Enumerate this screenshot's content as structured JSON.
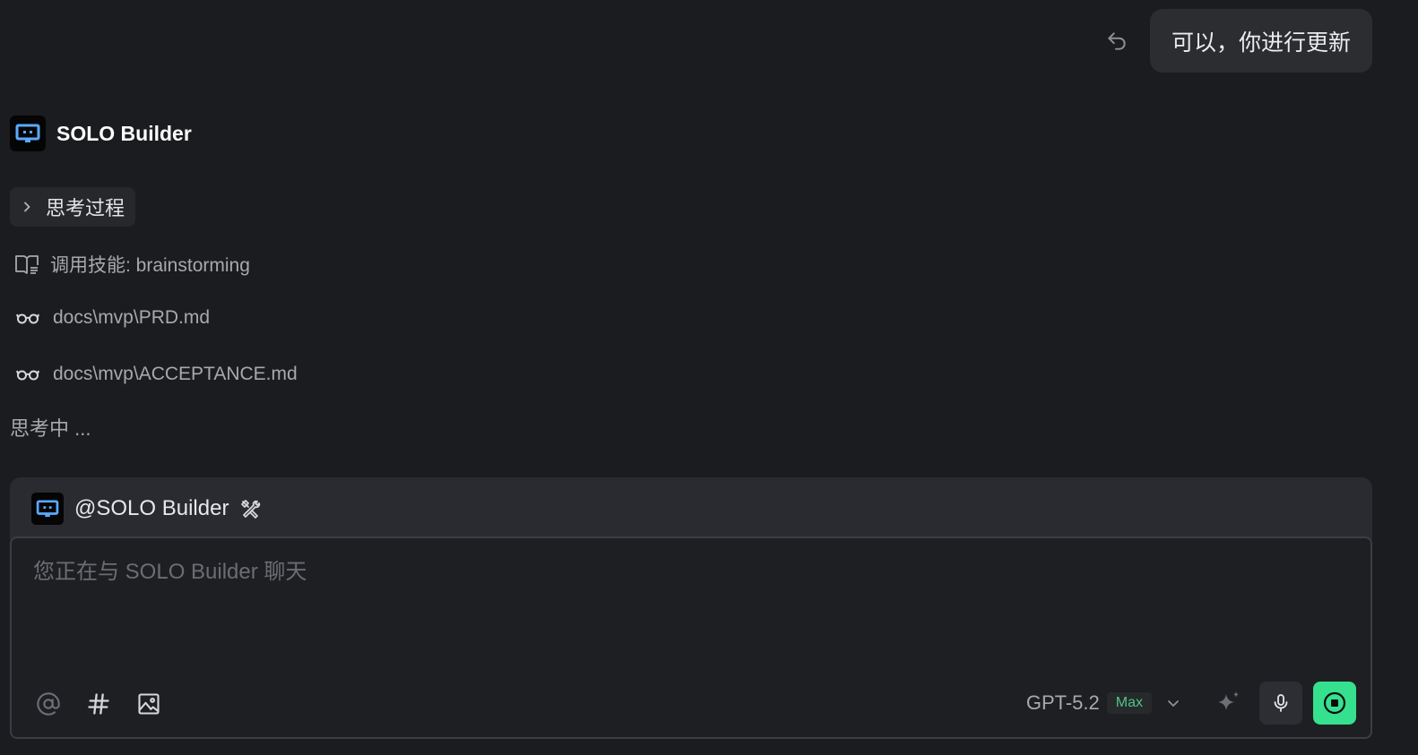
{
  "user_message": {
    "text": "可以，你进行更新",
    "undo_icon": "undo-icon"
  },
  "agent": {
    "name": "SOLO Builder",
    "avatar_icon": "bot-icon",
    "accent_color": "#5aa9ff"
  },
  "thought": {
    "label": "思考过程",
    "icon": "chevron-right-icon"
  },
  "steps": [
    {
      "icon": "book-icon",
      "text": "调用技能: brainstorming"
    },
    {
      "icon": "glasses-icon",
      "text": "docs\\mvp\\PRD.md"
    },
    {
      "icon": "glasses-icon",
      "text": "docs\\mvp\\ACCEPTANCE.md"
    }
  ],
  "status_text": "思考中 ...",
  "composer": {
    "mention_label": "@SOLO Builder",
    "mention_icon": "tools-icon",
    "placeholder": "您正在与 SOLO Builder 聊天",
    "value": "",
    "tools": [
      "at-icon",
      "hash-icon",
      "image-icon"
    ],
    "model": {
      "name": "GPT-5.2",
      "badge": "Max",
      "badge_color": "#4fc38a"
    },
    "stop_color": "#35e08e"
  }
}
